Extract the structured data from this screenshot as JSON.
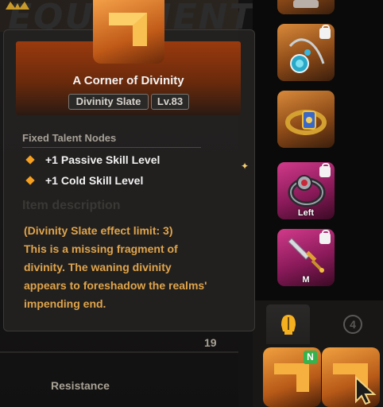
{
  "background": {
    "panel_title": "EQUIPMENT",
    "stat_value": "19",
    "resistance_label": "Resistance"
  },
  "tooltip": {
    "item_name": "A Corner of Divinity",
    "item_type": "Divinity Slate",
    "item_level": "Lv.83",
    "section_fixed_talent_nodes": "Fixed Talent Nodes",
    "nodes": [
      {
        "text": "+1 Passive Skill Level"
      },
      {
        "text": "+1 Cold Skill Level"
      }
    ],
    "section_item_description": "Item description",
    "description_lines": [
      "(Divinity Slate effect limit: 3)",
      "This is a missing fragment of",
      "divinity. The waning divinity",
      "appears to foreshadow the realms'",
      "impending end."
    ]
  },
  "equipment_slots": {
    "amulet_locked": true,
    "ring_left_label": "Left",
    "ring_left_locked": true,
    "weapon_label": "M",
    "weapon_locked": true
  },
  "lower_panel": {
    "tab_icons": [
      "helmet-icon",
      "circled-number-icon"
    ],
    "tab_number": "4",
    "new_badge": "N"
  },
  "colors": {
    "accent_orange": "#f5a020",
    "description_gold": "#e0a44a",
    "slot_orange": "#d98a3a",
    "slot_pink": "#d23a8a"
  }
}
